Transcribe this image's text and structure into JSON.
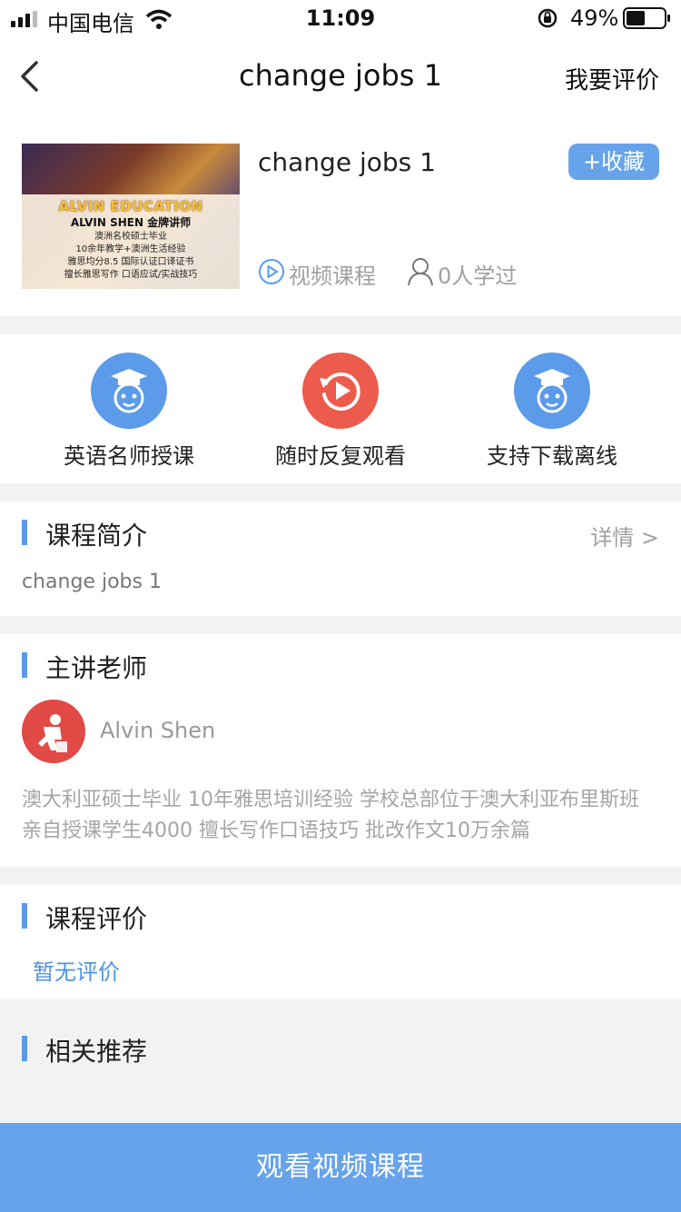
{
  "status_bar": {
    "carrier": "中国电信",
    "time": "11:09",
    "battery": "49%"
  },
  "nav": {
    "title": "change jobs 1",
    "right_action": "我要评价"
  },
  "course": {
    "title": "change jobs 1",
    "favorite_label": "+收藏",
    "type_label": "视频课程",
    "learners_label": "0人学过",
    "thumbnail": {
      "logo": "ALVIN EDUCATION",
      "subtitle": "ALVIN SHEN 金牌讲师",
      "lines": [
        "澳洲名校硕士毕业",
        "10余年教学+澳洲生活经验",
        "雅思均分8.5 国际认证口译证书",
        "擅长雅思写作 口语应试/实战技巧"
      ]
    }
  },
  "features": [
    {
      "label": "英语名师授课",
      "icon": "teacher-icon",
      "color": "#5c9be9"
    },
    {
      "label": "随时反复观看",
      "icon": "replay-icon",
      "color": "#ed5b4c"
    },
    {
      "label": "支持下载离线",
      "icon": "teacher-icon",
      "color": "#5c9be9"
    }
  ],
  "intro": {
    "title": "课程简介",
    "detail_link": "详情 >",
    "text": "change jobs 1"
  },
  "teacher": {
    "title": "主讲老师",
    "name": "Alvin Shen",
    "description": "澳大利亚硕士毕业 10年雅思培训经验 学校总部位于澳大利亚布里斯班 亲自授课学生4000 擅长写作口语技巧 批改作文10万余篇"
  },
  "reviews": {
    "title": "课程评价",
    "empty_text": "暂无评价"
  },
  "recommend": {
    "title": "相关推荐"
  },
  "bottom_button": "观看视频课程",
  "colors": {
    "accent": "#66a3ea",
    "red": "#ed5b4c",
    "link": "#4e93e4"
  }
}
